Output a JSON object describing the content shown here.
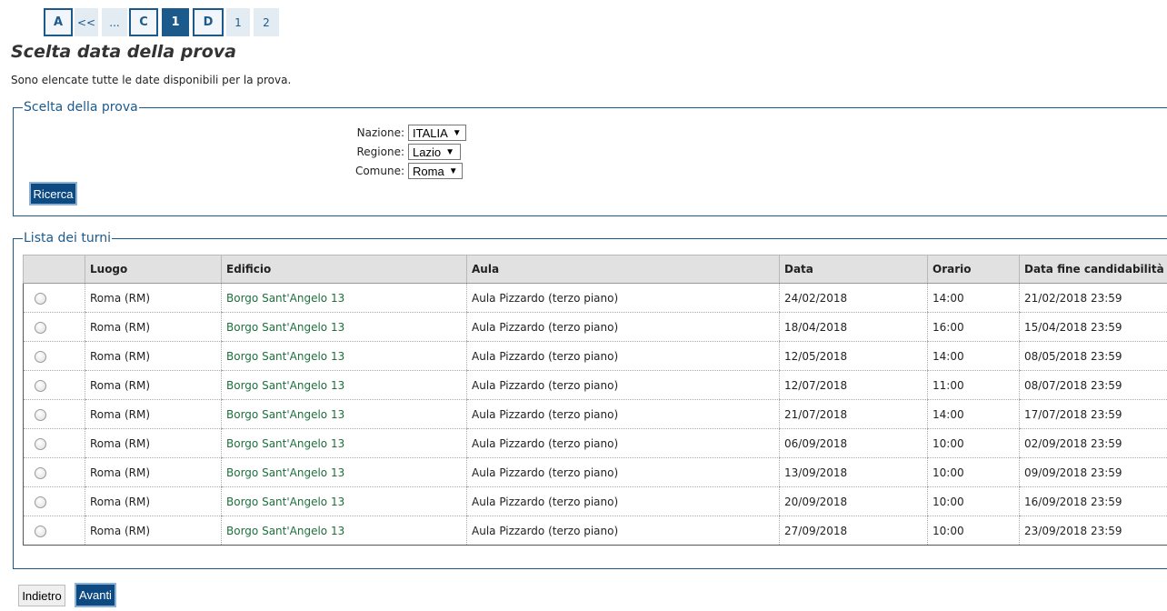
{
  "pagination": {
    "items": [
      {
        "label": "A"
      },
      {
        "label": "<<"
      },
      {
        "label": "..."
      },
      {
        "label": "C"
      },
      {
        "label": "1"
      },
      {
        "label": "D"
      },
      {
        "label": "1"
      },
      {
        "label": "2"
      }
    ],
    "current_index": 4
  },
  "page": {
    "title": "Scelta data della prova",
    "intro": "Sono elencate tutte le date disponibili per la prova."
  },
  "search": {
    "legend": "Scelta della prova",
    "fields": [
      {
        "label": "Nazione:",
        "value": "ITALIA"
      },
      {
        "label": "Regione:",
        "value": "Lazio"
      },
      {
        "label": "Comune:",
        "value": "Roma"
      }
    ],
    "button_label": "Ricerca"
  },
  "list": {
    "legend": "Lista dei turni",
    "columns": [
      "",
      "Luogo",
      "Edificio",
      "Aula",
      "Data",
      "Orario",
      "Data fine candidabilità"
    ],
    "rows": [
      {
        "luogo": "Roma (RM)",
        "edificio": "Borgo Sant'Angelo 13",
        "aula": "Aula Pizzardo (terzo piano)",
        "data": "24/02/2018",
        "orario": "14:00",
        "fine": "21/02/2018 23:59"
      },
      {
        "luogo": "Roma (RM)",
        "edificio": "Borgo Sant'Angelo 13",
        "aula": "Aula Pizzardo (terzo piano)",
        "data": "18/04/2018",
        "orario": "16:00",
        "fine": "15/04/2018 23:59"
      },
      {
        "luogo": "Roma (RM)",
        "edificio": "Borgo Sant'Angelo 13",
        "aula": "Aula Pizzardo (terzo piano)",
        "data": "12/05/2018",
        "orario": "14:00",
        "fine": "08/05/2018 23:59"
      },
      {
        "luogo": "Roma (RM)",
        "edificio": "Borgo Sant'Angelo 13",
        "aula": "Aula Pizzardo (terzo piano)",
        "data": "12/07/2018",
        "orario": "11:00",
        "fine": "08/07/2018 23:59"
      },
      {
        "luogo": "Roma (RM)",
        "edificio": "Borgo Sant'Angelo 13",
        "aula": "Aula Pizzardo (terzo piano)",
        "data": "21/07/2018",
        "orario": "14:00",
        "fine": "17/07/2018 23:59"
      },
      {
        "luogo": "Roma (RM)",
        "edificio": "Borgo Sant'Angelo 13",
        "aula": "Aula Pizzardo (terzo piano)",
        "data": "06/09/2018",
        "orario": "10:00",
        "fine": "02/09/2018 23:59"
      },
      {
        "luogo": "Roma (RM)",
        "edificio": "Borgo Sant'Angelo 13",
        "aula": "Aula Pizzardo (terzo piano)",
        "data": "13/09/2018",
        "orario": "10:00",
        "fine": "09/09/2018 23:59"
      },
      {
        "luogo": "Roma (RM)",
        "edificio": "Borgo Sant'Angelo 13",
        "aula": "Aula Pizzardo (terzo piano)",
        "data": "20/09/2018",
        "orario": "10:00",
        "fine": "16/09/2018 23:59"
      },
      {
        "luogo": "Roma (RM)",
        "edificio": "Borgo Sant'Angelo 13",
        "aula": "Aula Pizzardo (terzo piano)",
        "data": "27/09/2018",
        "orario": "10:00",
        "fine": "23/09/2018 23:59"
      }
    ]
  },
  "footer": {
    "back_label": "Indietro",
    "next_label": "Avanti"
  },
  "colors": {
    "accent": "#1c5a8c",
    "button": "#0e4a82",
    "link_green": "#1e6f3c"
  }
}
